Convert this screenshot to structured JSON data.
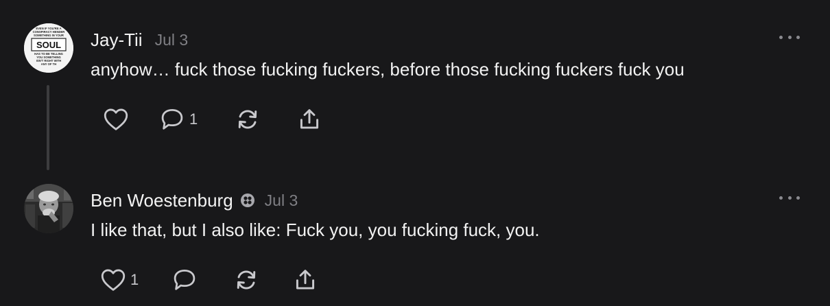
{
  "posts": [
    {
      "author": "Jay-Tii",
      "date": "Jul 3",
      "text": "anyhow… fuck those fucking fuckers, before those fucking fuckers fuck you",
      "avatar_text": {
        "top_lines": [
          "EVEN IF YOU'RE A",
          "CONSPIRACY HENDER",
          "SOMETHING IN YOUR"
        ],
        "main": "SOUL",
        "bottom_lines": [
          "HAS TO BE TELLING",
          "YOU SOMETHING",
          "ISN'T RIGHT WITH",
          "ANY OF TH"
        ]
      },
      "actions": {
        "like_count": "",
        "comment_count": "1"
      }
    },
    {
      "author": "Ben Woestenburg",
      "date": "Jul 3",
      "text": "I like that, but I also like: Fuck you, you fucking fuck, you.",
      "actions": {
        "like_count": "1",
        "comment_count": ""
      }
    }
  ],
  "icons": {
    "like": "heart-icon",
    "comment": "comment-bubble-icon",
    "restack": "restack-icon",
    "share": "share-icon",
    "more": "more-dots-icon",
    "badge": "subscriber-badge-icon"
  },
  "colors": {
    "background": "#18181a",
    "text": "#f2f2f2",
    "muted": "#7f7f84",
    "icon": "#c9c9cd"
  }
}
